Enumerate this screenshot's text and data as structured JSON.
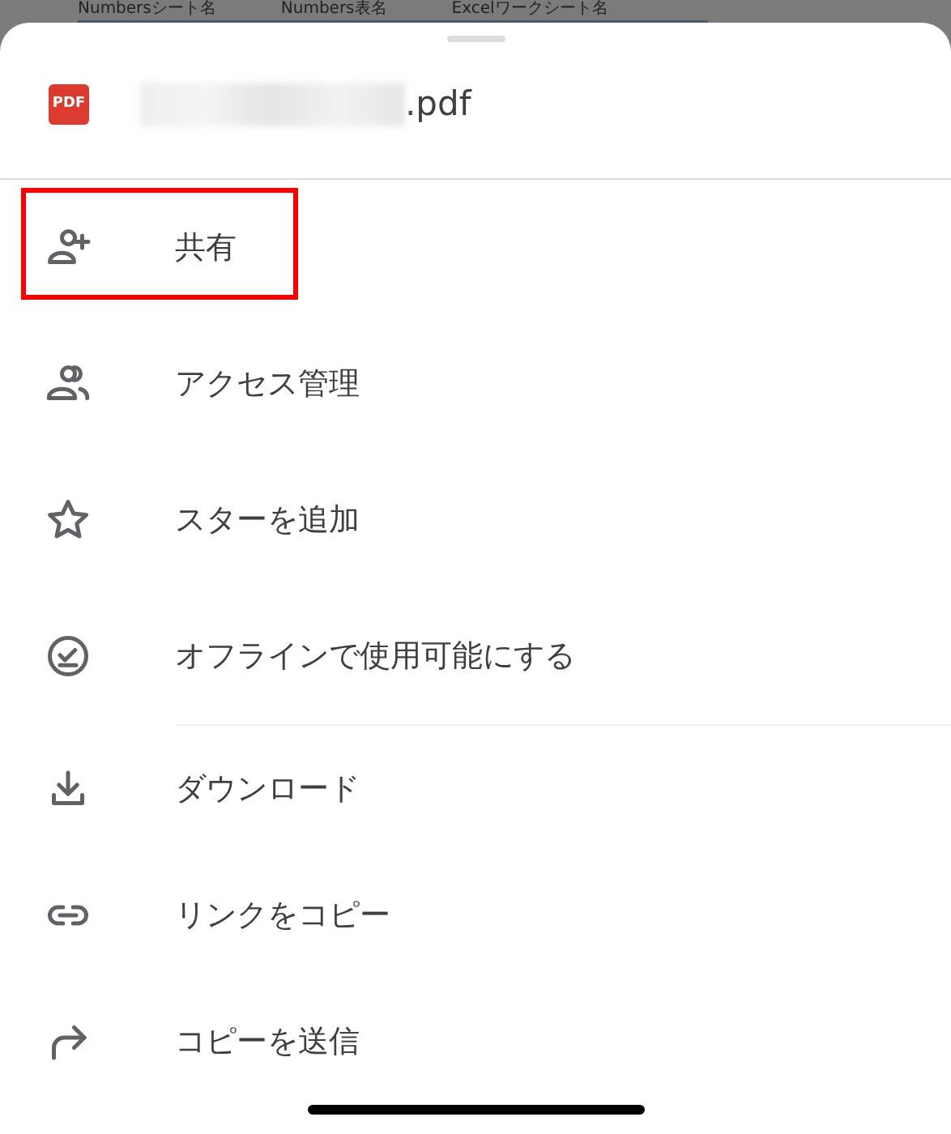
{
  "background": {
    "column_headers": [
      "Numbersシート名",
      "Numbers表名",
      "Excelワークシート名"
    ]
  },
  "file": {
    "name_visible": ".pdf",
    "name_redacted": true,
    "type_badge": "PDF"
  },
  "menu_groups": [
    [
      {
        "label": "共有",
        "highlighted": true
      },
      {
        "label": "アクセス管理",
        "highlighted": false
      },
      {
        "label": "スターを追加",
        "highlighted": false
      },
      {
        "label": "オフラインで使用可能にする",
        "highlighted": false
      }
    ],
    [
      {
        "label": "ダウンロード",
        "highlighted": false
      },
      {
        "label": "リンクをコピー",
        "highlighted": false
      },
      {
        "label": "コピーを送信",
        "highlighted": false
      }
    ]
  ]
}
